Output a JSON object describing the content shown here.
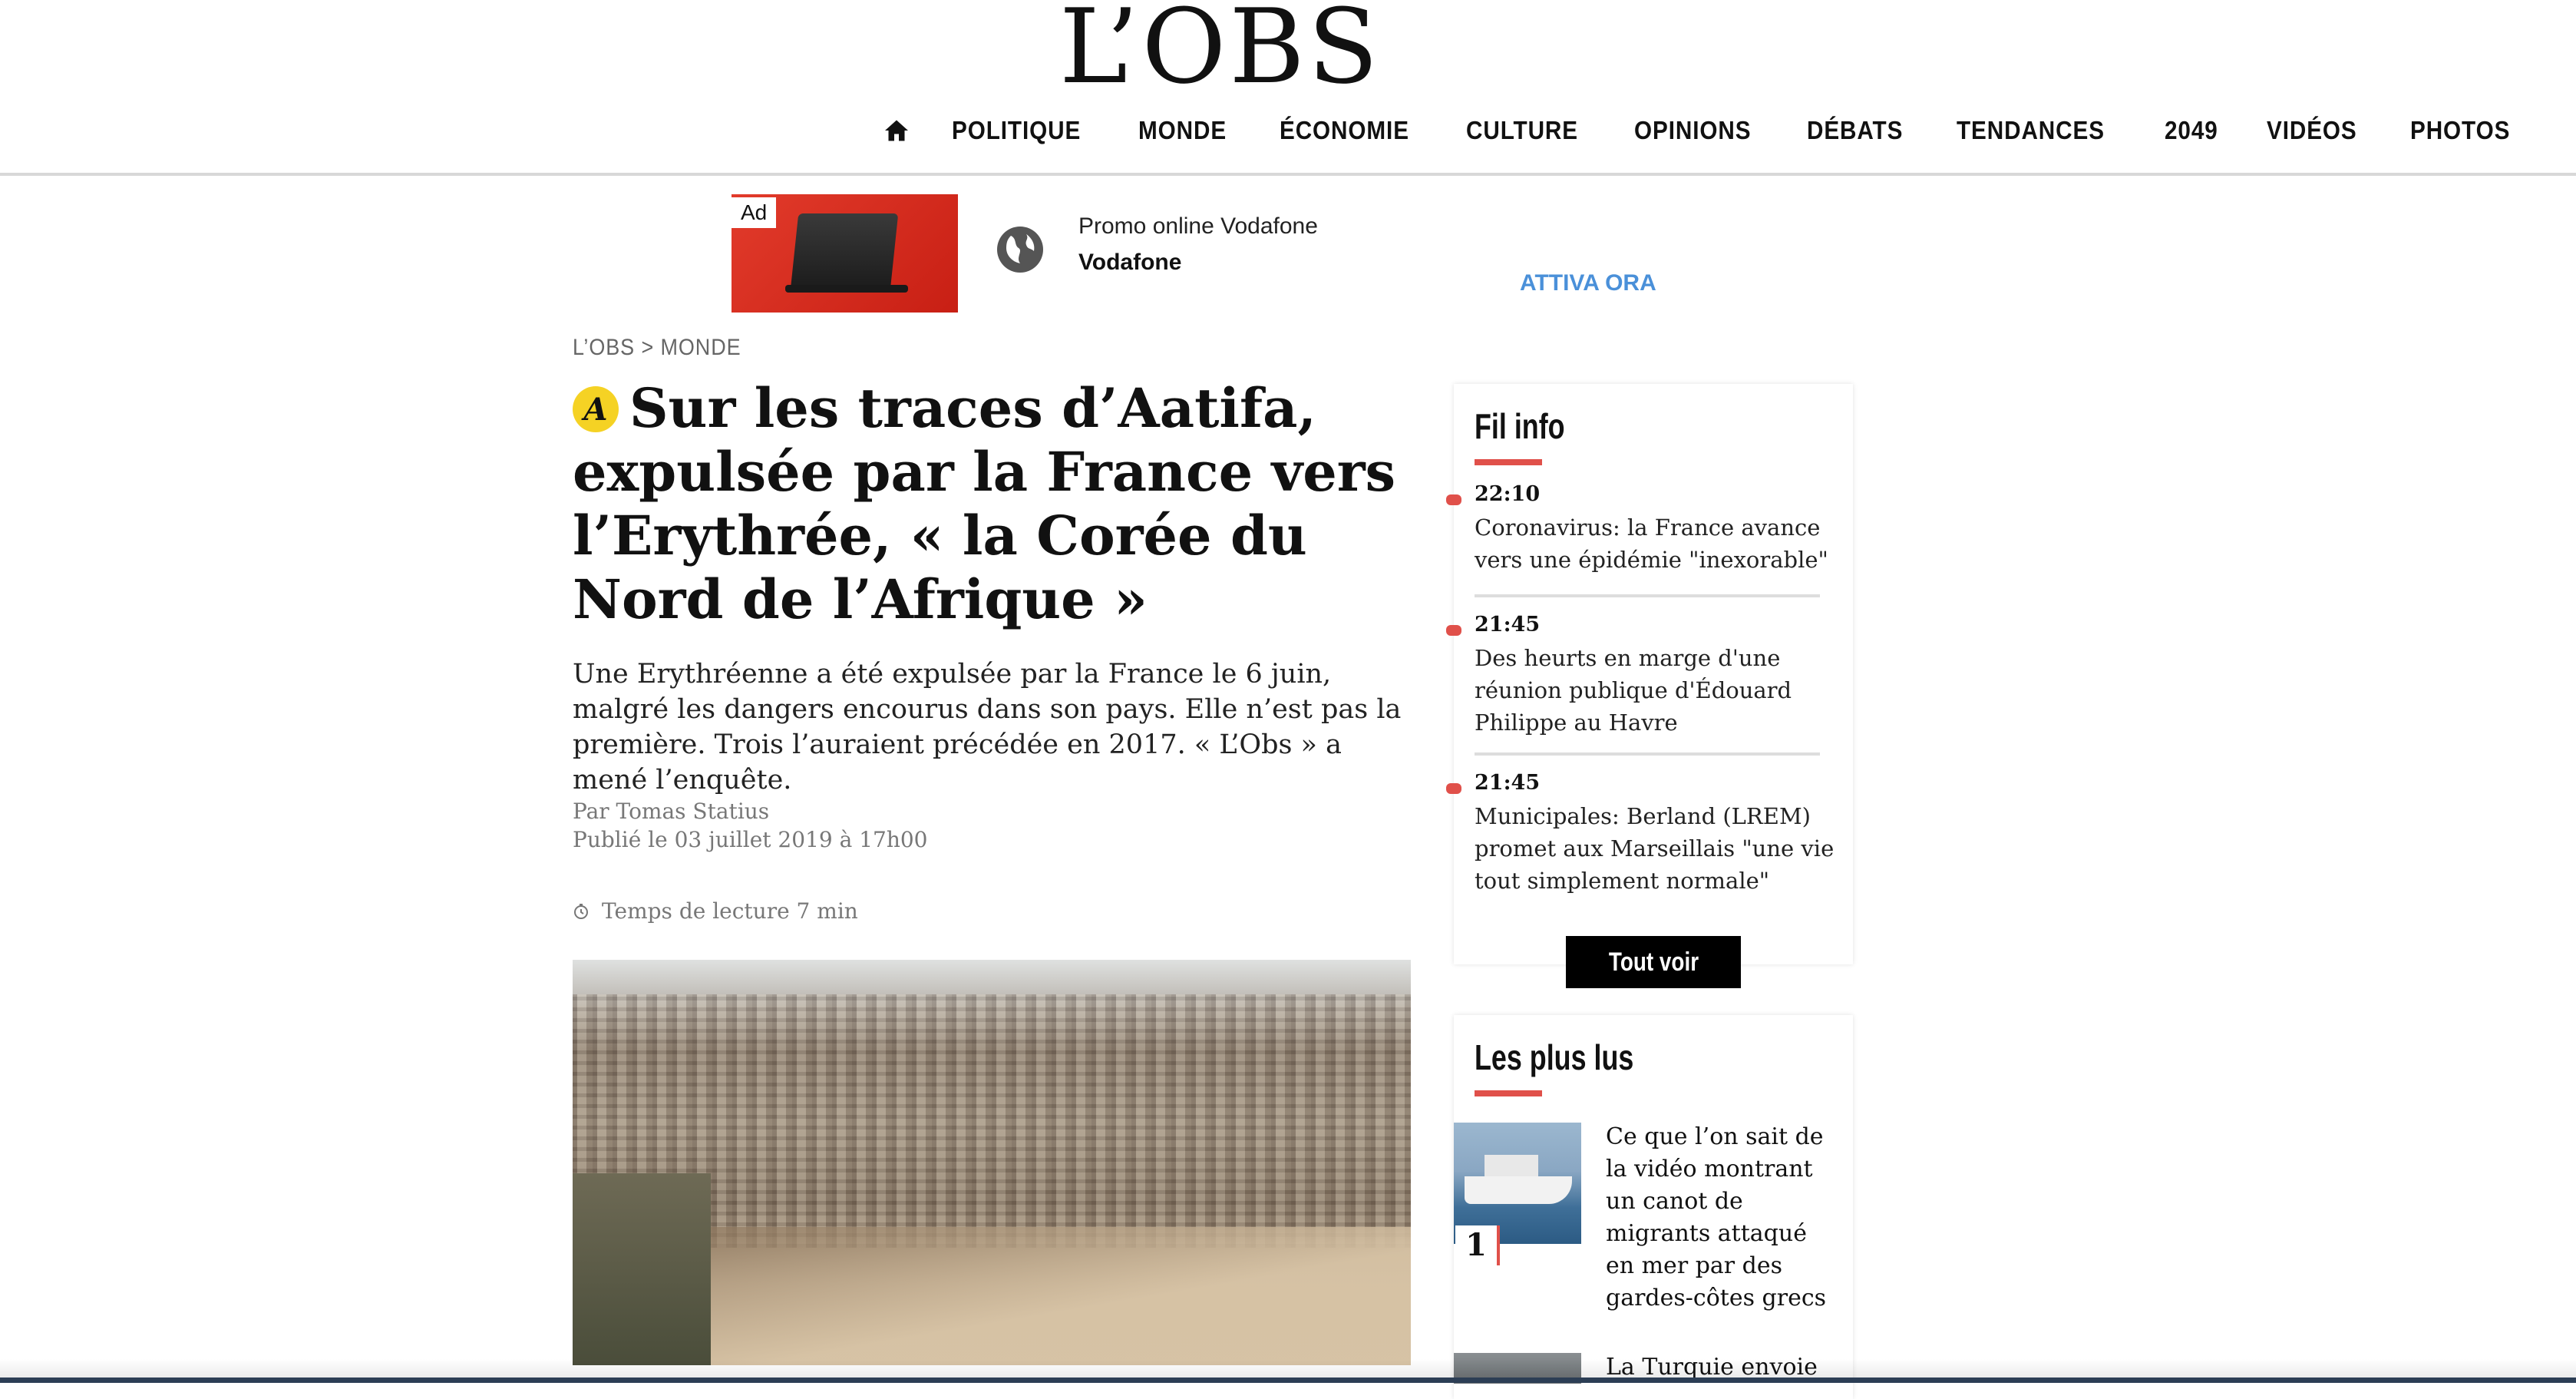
{
  "header": {
    "logo": "L’OBS",
    "nav": [
      "POLITIQUE",
      "MONDE",
      "ÉCONOMIE",
      "CULTURE",
      "OPINIONS",
      "DÉBATS",
      "TENDANCES",
      "2049",
      "VIDÉOS",
      "PHOTOS"
    ]
  },
  "ad": {
    "badge": "Ad",
    "title": "Promo online Vodafone",
    "brand": "Vodafone",
    "cta": "ATTIVA ORA"
  },
  "article": {
    "breadcrumb": "L’OBS > MONDE",
    "badge_letter": "A",
    "headline": "Sur les traces d’Aatifa, expulsée par la France vers l’Erythrée, « la Corée du Nord de l’Afrique »",
    "chapo": "Une Erythréenne a été expulsée par la France le 6 juin, malgré les dangers encourus dans son pays. Elle n’est pas la première. Trois l’auraient précédée en 2017. « L’Obs » a mené l’enquête.",
    "byline": "Par Tomas Statius",
    "published": "Publié le 03 juillet 2019 à 17h00",
    "reading_time": "Temps de lecture 7 min"
  },
  "fil_info": {
    "title": "Fil info",
    "items": [
      {
        "time": "22:10",
        "text": "Coronavirus: la France avance vers une épidémie \"inexorable\""
      },
      {
        "time": "21:45",
        "text": "Des heurts en marge d'une réunion publique d'Édouard Philippe au Havre"
      },
      {
        "time": "21:45",
        "text": "Municipales: Berland (LREM) promet aux Marseillais \"une vie tout simplement normale\""
      }
    ],
    "button": "Tout voir"
  },
  "les_plus_lus": {
    "title": "Les plus lus",
    "items": [
      {
        "rank": "1",
        "text": "Ce que l’on sait de la vidéo montrant un canot de migrants attaqué en mer par des gardes-côtes grecs"
      },
      {
        "text": "La Turquie envoie"
      }
    ]
  },
  "colors": {
    "accent_red": "#e0504a",
    "badge_yellow": "#f5d224",
    "cta_blue": "#4a90d9"
  }
}
